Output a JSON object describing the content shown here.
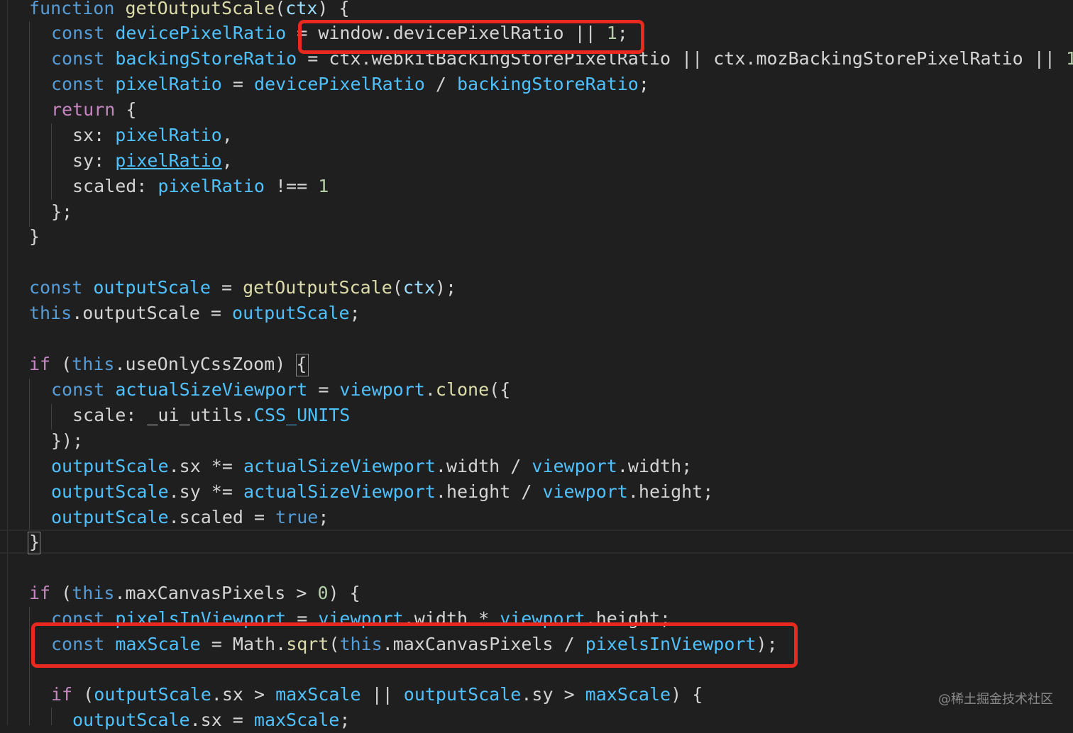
{
  "code": {
    "l01": {
      "t1": "function",
      "t2": "getOutputScale",
      "t3": "(",
      "t4": "ctx",
      "t5": ") {"
    },
    "l02": {
      "t1": "const",
      "t2": "devicePixelRatio",
      "t3": " = ",
      "t4": "window",
      "t5": ".",
      "t6": "devicePixelRatio",
      "t7": " || ",
      "t8": "1",
      "t9": ";"
    },
    "l03": {
      "t1": "const",
      "t2": "backingStoreRatio",
      "t3": " = ",
      "t4": "ctx",
      "t5": ".",
      "t6": "webkitBackingStorePixelRatio",
      "t7": " || ",
      "t8": "ctx",
      "t9": ".",
      "t10": "mozBackingStorePixelRatio",
      "t11": " || ",
      "t12": "1"
    },
    "l04": {
      "t1": "const",
      "t2": "pixelRatio",
      "t3": " = ",
      "t4": "devicePixelRatio",
      "t5": " / ",
      "t6": "backingStoreRatio",
      "t7": ";"
    },
    "l05": {
      "t1": "return",
      "t2": " {"
    },
    "l06": {
      "t1": "sx: ",
      "t2": "pixelRatio",
      "t3": ","
    },
    "l07": {
      "t1": "sy: ",
      "t2": "pixelRatio",
      "t3": ","
    },
    "l08": {
      "t1": "scaled: ",
      "t2": "pixelRatio",
      "t3": " !== ",
      "t4": "1"
    },
    "l09": {
      "t1": "};"
    },
    "l10": {
      "t1": "}"
    },
    "l11": {
      "t1": "const",
      "t2": "outputScale",
      "t3": " = ",
      "t4": "getOutputScale",
      "t5": "(",
      "t6": "ctx",
      "t7": ");"
    },
    "l12": {
      "t1": "this",
      "t2": ".",
      "t3": "outputScale",
      "t4": " = ",
      "t5": "outputScale",
      "t6": ";"
    },
    "l13": {
      "t1": "if",
      "t2": " (",
      "t3": "this",
      "t4": ".",
      "t5": "useOnlyCssZoom",
      "t6": ") ",
      "t7": "{"
    },
    "l14": {
      "t1": "const",
      "t2": "actualSizeViewport",
      "t3": " = ",
      "t4": "viewport",
      "t5": ".",
      "t6": "clone",
      "t7": "({"
    },
    "l15": {
      "t1": "scale: ",
      "t2": "_ui_utils",
      "t3": ".",
      "t4": "CSS_UNITS"
    },
    "l16": {
      "t1": "});"
    },
    "l17": {
      "t1": "outputScale",
      "t2": ".",
      "t3": "sx",
      "t4": " *= ",
      "t5": "actualSizeViewport",
      "t6": ".",
      "t7": "width",
      "t8": " / ",
      "t9": "viewport",
      "t10": ".",
      "t11": "width",
      "t12": ";"
    },
    "l18": {
      "t1": "outputScale",
      "t2": ".",
      "t3": "sy",
      "t4": " *= ",
      "t5": "actualSizeViewport",
      "t6": ".",
      "t7": "height",
      "t8": " / ",
      "t9": "viewport",
      "t10": ".",
      "t11": "height",
      "t12": ";"
    },
    "l19": {
      "t1": "outputScale",
      "t2": ".",
      "t3": "scaled",
      "t4": " = ",
      "t5": "true",
      "t6": ";"
    },
    "l20": {
      "t1": "}"
    },
    "l21": {
      "t1": "if",
      "t2": " (",
      "t3": "this",
      "t4": ".",
      "t5": "maxCanvasPixels",
      "t6": " > ",
      "t7": "0",
      "t8": ") {"
    },
    "l22": {
      "t1": "const",
      "t2": "pixelsInViewport",
      "t3": " = ",
      "t4": "viewport",
      "t5": ".",
      "t6": "width",
      "t7": " * ",
      "t8": "viewport",
      "t9": ".",
      "t10": "height",
      "t11": ";"
    },
    "l23": {
      "t1": "const",
      "t2": "maxScale",
      "t3": " = ",
      "t4": "Math",
      "t5": ".",
      "t6": "sqrt",
      "t7": "(",
      "t8": "this",
      "t9": ".",
      "t10": "maxCanvasPixels",
      "t11": " / ",
      "t12": "pixelsInViewport",
      "t13": ");"
    },
    "l24": {
      "t1": "if",
      "t2": " (",
      "t3": "outputScale",
      "t4": ".",
      "t5": "sx",
      "t6": " > ",
      "t7": "maxScale",
      "t8": " || ",
      "t9": "outputScale",
      "t10": ".",
      "t11": "sy",
      "t12": " > ",
      "t13": "maxScale",
      "t14": ") {"
    },
    "l25": {
      "t1": "outputScale",
      "t2": ".",
      "t3": "sx",
      "t4": " = ",
      "t5": "maxScale",
      "t6": ";"
    }
  },
  "watermark": "@稀土掘金技术社区",
  "colors": {
    "background": "#1f1f1f",
    "keyword": "#569cd6",
    "variable": "#9cdcfe",
    "function": "#dcdcaa",
    "number": "#b5cea8",
    "highlight_box": "#e8291f"
  }
}
